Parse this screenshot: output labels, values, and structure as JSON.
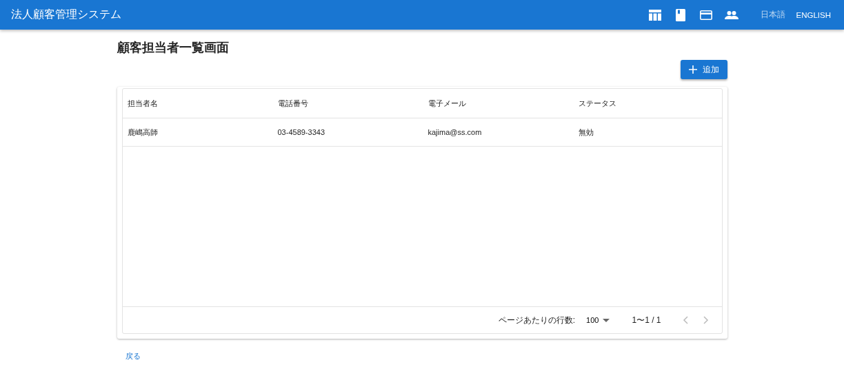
{
  "app_bar": {
    "title": "法人顧客管理システム",
    "nav_icons": [
      {
        "kind": "table"
      },
      {
        "kind": "book"
      },
      {
        "kind": "card"
      },
      {
        "kind": "people"
      }
    ],
    "languages": [
      {
        "label": "日本語",
        "selected": true
      },
      {
        "label": "ENGLISH",
        "selected": false
      }
    ]
  },
  "page": {
    "title": "顧客担当者一覧画面",
    "add_button": "追加"
  },
  "table": {
    "columns": [
      "担当者名",
      "電話番号",
      "電子メール",
      "ステータス"
    ],
    "rows": [
      [
        "鹿嶋高師",
        "03-4589-3343",
        "kajima@ss.com",
        "無効"
      ]
    ]
  },
  "pagination": {
    "rows_per_page_label": "ページあたりの行数:",
    "rows_per_page": "100",
    "range": "1〜1 / 1",
    "prev_disabled": true,
    "next_disabled": true
  },
  "back_link": "戻る"
}
